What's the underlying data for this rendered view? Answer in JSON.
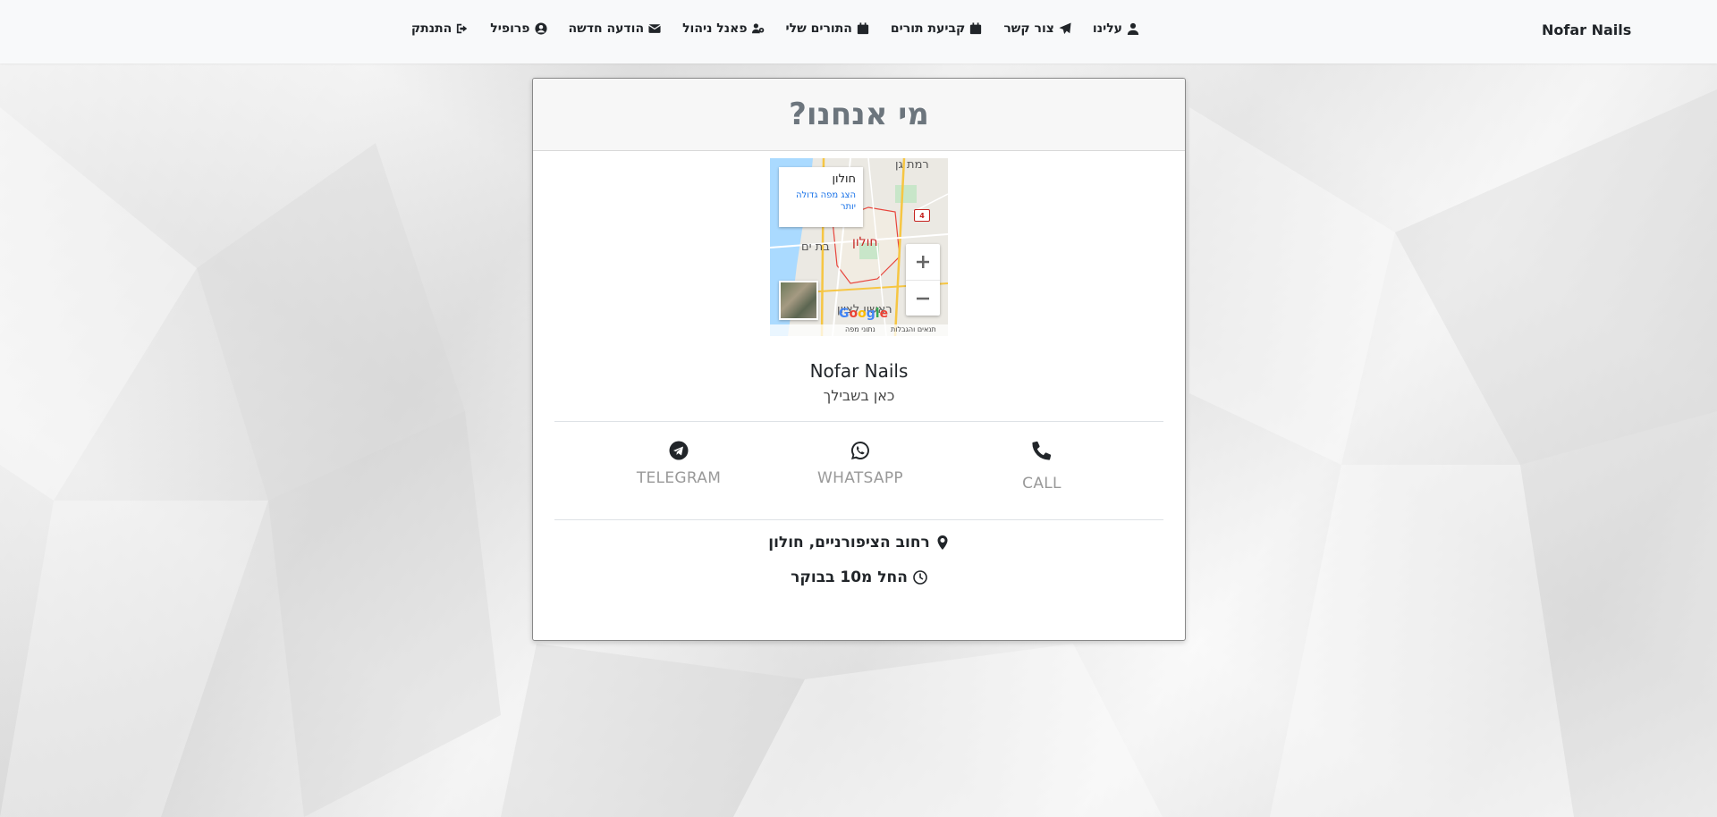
{
  "navbar": {
    "brand": "Nofar Nails",
    "items": [
      {
        "label": "עלינו",
        "icon": "user-icon"
      },
      {
        "label": "צור קשר",
        "icon": "paper-plane-icon"
      },
      {
        "label": "קביעת תורים",
        "icon": "calendar-icon"
      },
      {
        "label": "התורים שלי",
        "icon": "calendar-icon"
      },
      {
        "label": "פאנל ניהול",
        "icon": "users-cog-icon"
      },
      {
        "label": "הודעה חדשה",
        "icon": "envelope-icon"
      },
      {
        "label": "פרופיל",
        "icon": "user-circle-icon"
      },
      {
        "label": "התנתק",
        "icon": "sign-out-icon"
      }
    ]
  },
  "card": {
    "title": "מי אנחנו?",
    "business_name": "Nofar Nails",
    "tagline": "כאן בשבילך",
    "map": {
      "place_name": "חולון",
      "larger_map_link": "הצג מפה גדולה יותר",
      "city_label": "חולון",
      "labels": [
        "רמת גן",
        "בת ים",
        "ראשון לציון"
      ],
      "highway_number": "4",
      "google": [
        "G",
        "o",
        "o",
        "g",
        "l",
        "e"
      ],
      "map_data_text": "נתוני מפה",
      "terms_text": "תנאים והגבלות"
    },
    "contacts": [
      {
        "label": "TELEGRAM",
        "icon": "telegram-icon"
      },
      {
        "label": "WHATSAPP",
        "icon": "whatsapp-icon"
      },
      {
        "label": "CALL",
        "icon": "phone-icon"
      }
    ],
    "address": "רחוב הציפורניים, חולון",
    "hours": "החל מ10 בבוקר"
  }
}
